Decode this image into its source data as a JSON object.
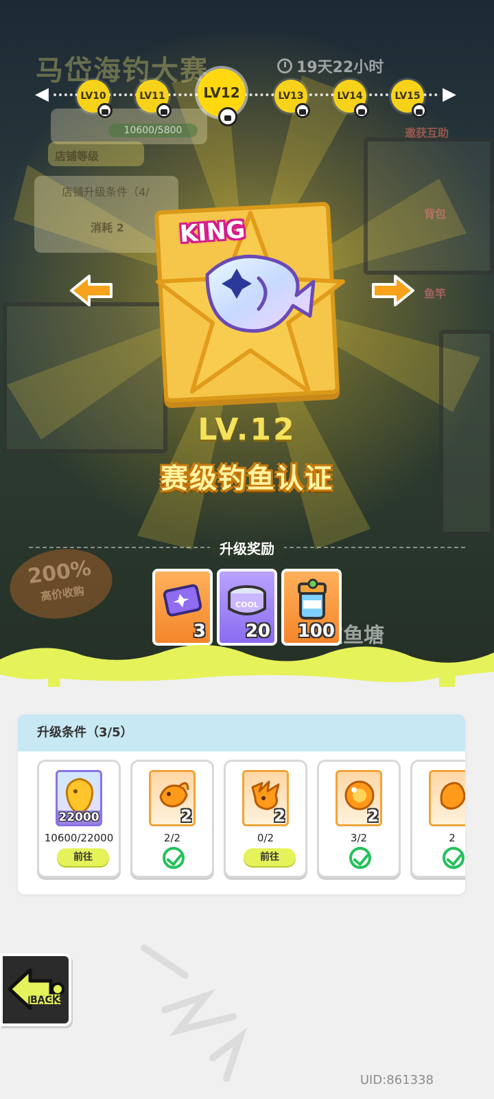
{
  "header": {
    "event_title": "马岱海钓大赛",
    "countdown": "19天22小时"
  },
  "level_nav": {
    "nodes": [
      {
        "label": "LV10",
        "locked": true
      },
      {
        "label": "LV11",
        "locked": true
      },
      {
        "label": "LV12",
        "locked": true,
        "current": true
      },
      {
        "label": "LV13",
        "locked": true
      },
      {
        "label": "LV14",
        "locked": true
      },
      {
        "label": "LV15",
        "locked": true
      }
    ]
  },
  "background": {
    "store_level_label": "店铺等级",
    "store_upgrade_label": "店铺升级条件（4/",
    "progress_text": "10600/5800",
    "consume_text": "消耗 2",
    "side_help": "邀获互助",
    "side_bag": "背包",
    "side_rod": "鱼竿",
    "promo_percent": "200%",
    "promo_text": "高价收购",
    "friend_pond": "好友鱼塘"
  },
  "certificate": {
    "tag": "KING",
    "level_text": "LV.12",
    "name": "赛级钓鱼认证"
  },
  "rewards": {
    "title": "升级奖励",
    "items": [
      {
        "icon": "ticket-icon",
        "count": "3",
        "style": "orange"
      },
      {
        "icon": "cat-food-can-icon",
        "count": "20",
        "style": "purple"
      },
      {
        "icon": "bait-jar-icon",
        "count": "100",
        "style": "orange"
      }
    ]
  },
  "conditions": {
    "title": "升级条件（3/5）",
    "items": [
      {
        "icon": "gold-fish-coin-icon",
        "badge": "22000",
        "progress": "10600/22000",
        "action": "前往",
        "done": false,
        "style": "purple"
      },
      {
        "icon": "goldfish-icon",
        "badge": "2",
        "progress": "2/2",
        "done": true,
        "style": "orange"
      },
      {
        "icon": "lionfish-icon",
        "badge": "2",
        "progress": "0/2",
        "action": "前往",
        "done": false,
        "style": "orange"
      },
      {
        "icon": "orange-pearl-icon",
        "badge": "2",
        "progress": "3/2",
        "done": true,
        "style": "orange"
      },
      {
        "icon": "coral-fish-icon",
        "badge": "",
        "progress": "2",
        "done": true,
        "style": "orange"
      }
    ]
  },
  "footer": {
    "back_label": "BACK",
    "uid": "UID:861338"
  },
  "colors": {
    "accent_yellow": "#ffd810",
    "slime_green": "#e5f25a",
    "check_green": "#23c15b",
    "panel_header": "#c8e8f3"
  }
}
